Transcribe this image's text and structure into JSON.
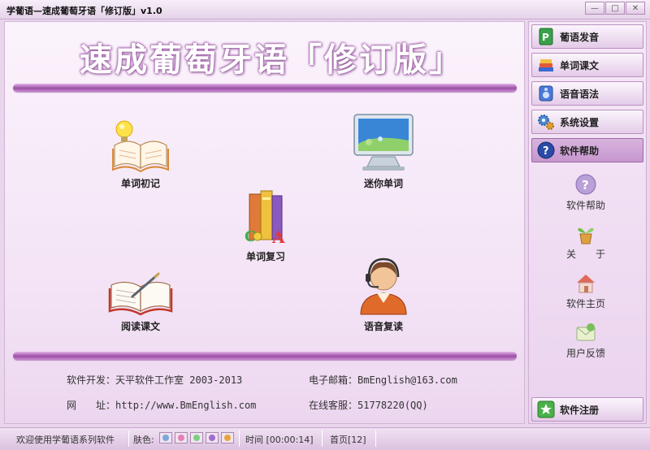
{
  "window": {
    "title": "学葡语—速成葡萄牙语「修订版」v1.0",
    "buttons": [
      "minimize",
      "maximize",
      "close"
    ]
  },
  "banner": {
    "text": "速成葡萄牙语「修订版」"
  },
  "features": {
    "word_initial": {
      "label": "单词初记",
      "icon": "open-book-lightbulb-icon"
    },
    "mini_words": {
      "label": "迷你单词",
      "icon": "monitor-icon"
    },
    "word_review": {
      "label": "单词复习",
      "icon": "books-abc-icon"
    },
    "reading": {
      "label": "阅读课文",
      "icon": "book-pen-icon"
    },
    "voice_repeat": {
      "label": "语音复读",
      "icon": "headset-operator-icon"
    }
  },
  "info": {
    "developer_label": "软件开发：",
    "developer_value": "天平软件工作室 2003-2013",
    "email_label": "电子邮箱：",
    "email_value": "BmEnglish@163.com",
    "website_label": "网　　址：",
    "website_value": "http://www.BmEnglish.com",
    "service_label": "在线客服：",
    "service_value": "51778220(QQ)"
  },
  "sidebar": {
    "nav": [
      {
        "label": "葡语发音",
        "icon": "p-book-icon"
      },
      {
        "label": "单词课文",
        "icon": "books-stack-icon"
      },
      {
        "label": "语音语法",
        "icon": "speaker-icon"
      },
      {
        "label": "系统设置",
        "icon": "gears-icon"
      },
      {
        "label": "软件帮助",
        "icon": "help-icon",
        "active": true
      }
    ],
    "help_items": [
      {
        "label": "软件帮助",
        "icon": "help-icon"
      },
      {
        "label": "关　　于",
        "icon": "plant-pot-icon"
      },
      {
        "label": "软件主页",
        "icon": "home-icon"
      },
      {
        "label": "用户反馈",
        "icon": "feedback-icon"
      }
    ],
    "register": {
      "label": "软件注册",
      "icon": "star-icon"
    }
  },
  "status": {
    "welcome": "欢迎使用学葡语系列软件",
    "skin_label": "肤色:",
    "skin_colors": [
      "#7ea6d6",
      "#e57fb7",
      "#7ccf7f",
      "#a26bcf",
      "#e8a43a"
    ],
    "time": "时间 [00:00:14]",
    "page": "首页[12]"
  }
}
